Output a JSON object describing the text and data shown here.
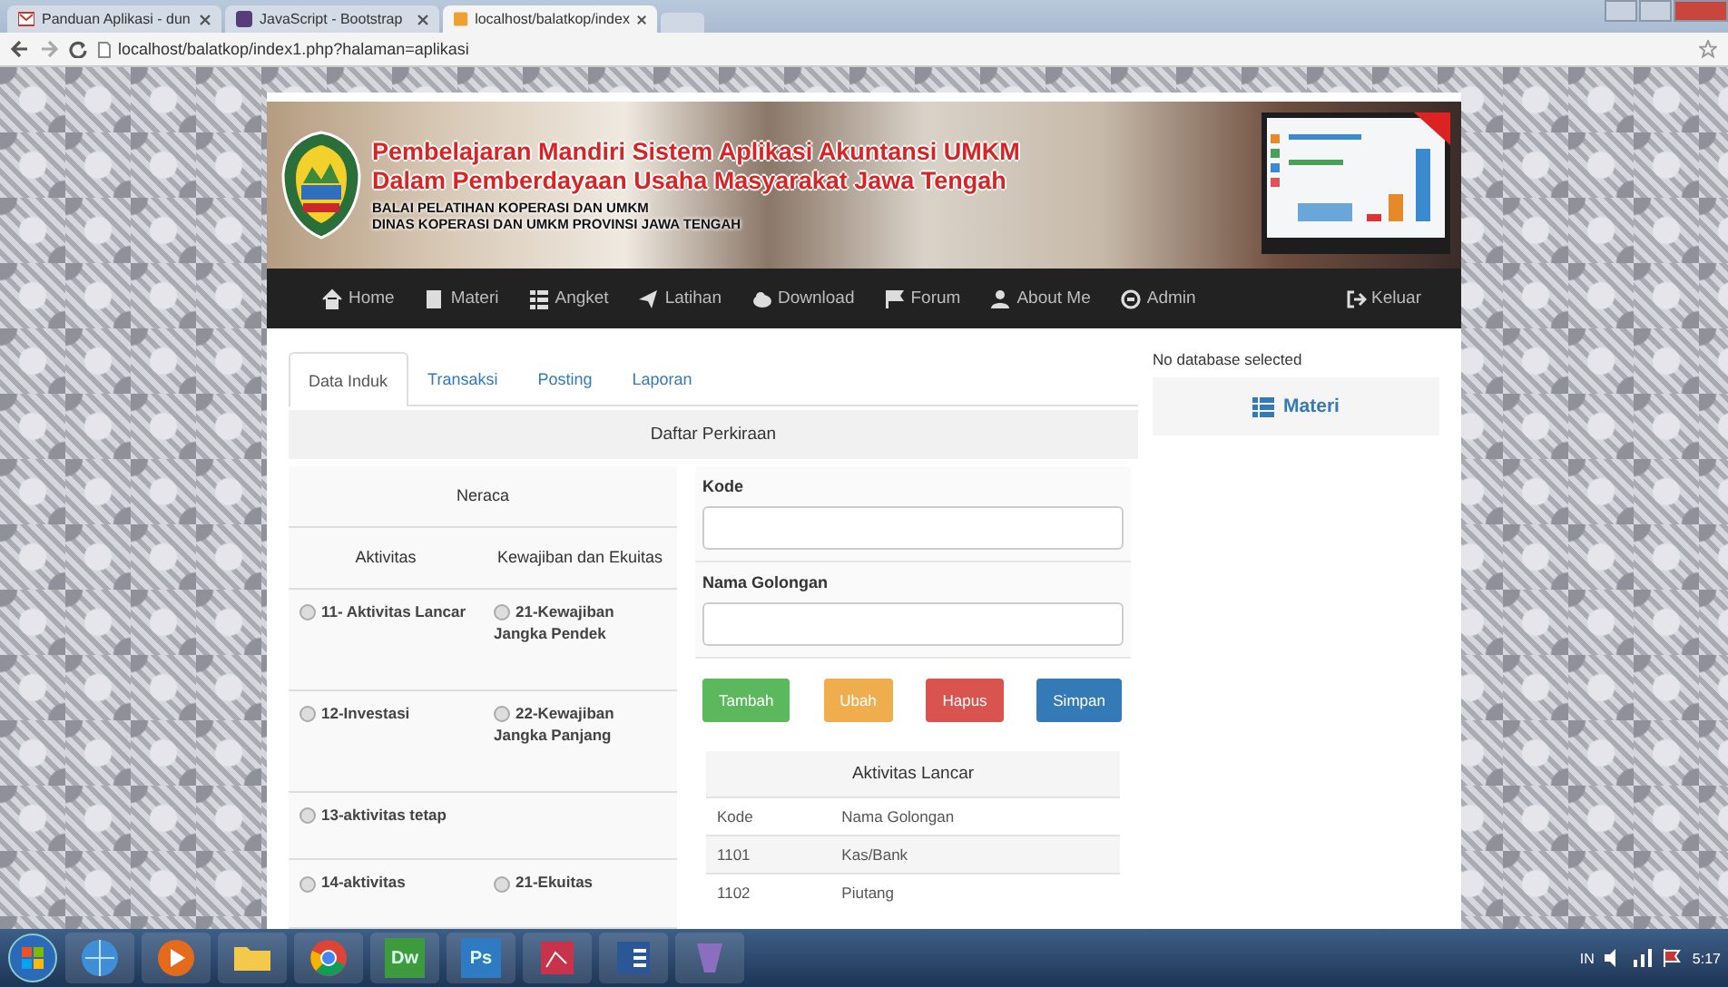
{
  "browser": {
    "tabs": [
      {
        "title": "Panduan Aplikasi - dun",
        "selected": false,
        "kind": "mail"
      },
      {
        "title": "JavaScript - Bootstrap",
        "selected": false,
        "kind": "bootstrap"
      },
      {
        "title": "localhost/balatkop/index",
        "selected": true,
        "kind": "page"
      }
    ],
    "url": "localhost/balatkop/index1.php?halaman=aplikasi"
  },
  "banner": {
    "title_lines": [
      "Pembelajaran Mandiri Sistem Aplikasi Akuntansi UMKM",
      "Dalam Pemberdayaan Usaha Masyarakat Jawa Tengah"
    ],
    "subtitle_lines": [
      "BALAI PELATIHAN KOPERASI DAN UMKM",
      "DINAS KOPERASI DAN UMKM PROVINSI JAWA TENGAH"
    ]
  },
  "nav": {
    "items": [
      {
        "label": "Home",
        "kind": "home"
      },
      {
        "label": "Materi",
        "kind": "book"
      },
      {
        "label": "Angket",
        "kind": "list"
      },
      {
        "label": "Latihan",
        "kind": "send"
      },
      {
        "label": "Download",
        "kind": "cloud"
      },
      {
        "label": "Forum",
        "kind": "flag"
      },
      {
        "label": "About Me",
        "kind": "user"
      },
      {
        "label": "Admin",
        "kind": "circle"
      },
      {
        "label": "Keluar",
        "kind": "exit"
      }
    ]
  },
  "tabs": [
    {
      "label": "Data Induk",
      "selected": true
    },
    {
      "label": "Transaksi",
      "selected": false
    },
    {
      "label": "Posting",
      "selected": false
    },
    {
      "label": "Laporan",
      "selected": false
    }
  ],
  "panel_title": "Daftar Perkiraan",
  "neraca": {
    "title": "Neraca",
    "columns": [
      "Aktivitas",
      "Kewajiban dan Ekuitas"
    ],
    "rows": [
      [
        {
          "label": "11- Aktivitas Lancar",
          "selected": false
        },
        {
          "label": "21-Kewajiban Jangka Pendek",
          "selected": false
        }
      ],
      [
        {
          "label": "12-Investasi",
          "selected": false
        },
        {
          "label": "22-Kewajiban Jangka Panjang",
          "selected": false
        }
      ],
      [
        {
          "label": "13-aktivitas tetap",
          "selected": false
        }
      ],
      [
        {
          "label": "14-aktivitas",
          "selected": false
        },
        {
          "label": "21-Ekuitas",
          "selected": false
        }
      ]
    ]
  },
  "form": {
    "fields": [
      {
        "label": "Kode"
      },
      {
        "label": "Nama Golongan"
      }
    ],
    "buttons": [
      {
        "label": "Tambah",
        "color": "#5cb85c"
      },
      {
        "label": "Ubah",
        "color": "#f0ad4e"
      },
      {
        "label": "Hapus",
        "color": "#d9534f"
      },
      {
        "label": "Simpan",
        "color": "#337ab7"
      }
    ]
  },
  "table": {
    "title": "Aktivitas Lancar",
    "columns": [
      "Kode",
      "Nama Golongan"
    ],
    "rows": [
      [
        "1101",
        "Kas/Bank"
      ],
      [
        "1102",
        "Piutang"
      ]
    ]
  },
  "sidebar": {
    "message": "No database selected",
    "panel_label": "Materi"
  },
  "taskbar": {
    "apps": [
      {
        "kind": "ie"
      },
      {
        "kind": "media"
      },
      {
        "kind": "folder"
      },
      {
        "kind": "chrome"
      },
      {
        "kind": "dw",
        "label": "Dw"
      },
      {
        "kind": "ps",
        "label": "Ps"
      },
      {
        "kind": "paint"
      },
      {
        "kind": "word"
      },
      {
        "kind": "other"
      }
    ],
    "language": "IN",
    "time": "5:17"
  }
}
